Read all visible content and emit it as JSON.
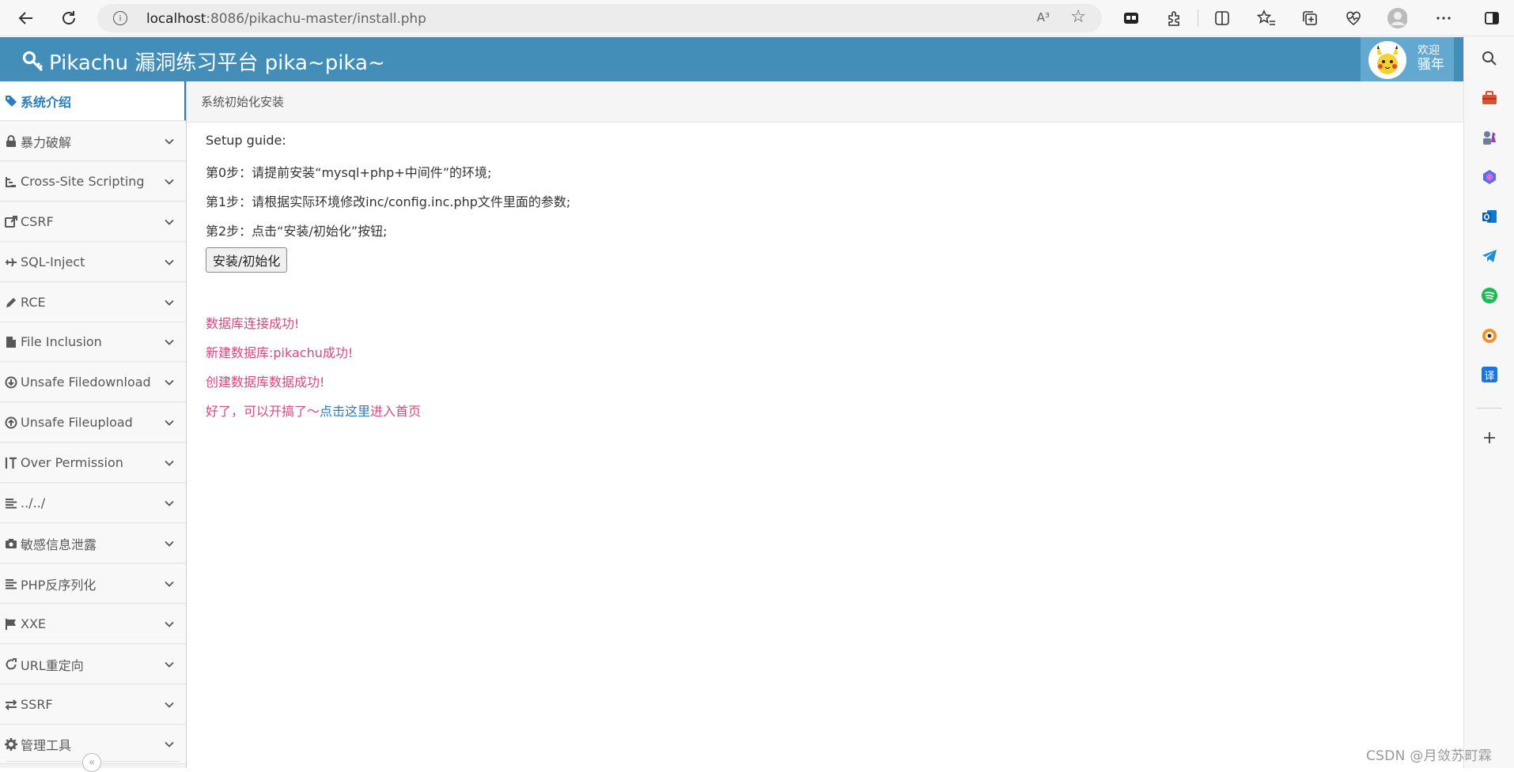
{
  "browser": {
    "url_host": "localhost",
    "url_rest": ":8086/pikachu-master/install.php",
    "read_aloud": "A³",
    "toolbar_icons": [
      "back-icon",
      "refresh-icon",
      "tab-actions-icon",
      "extensions-icon",
      "split-screen-icon",
      "favorites-icon",
      "collections-icon",
      "browser-essentials-icon",
      "profile-icon",
      "more-icon",
      "sidebar-toggle-icon"
    ]
  },
  "edge_sidebar": {
    "icons": [
      "search-icon",
      "tools-icon",
      "chess-icon",
      "copilot-icon",
      "outlook-icon",
      "telegram-icon",
      "spotify-icon",
      "game-icon",
      "translate-icon",
      "add-icon"
    ],
    "translate_glyph": "译"
  },
  "header": {
    "title": "Pikachu 漏洞练习平台 pika~pika~",
    "welcome": "欢迎",
    "user_name": "骚年"
  },
  "leftnav": {
    "items": [
      {
        "label": "系统介绍",
        "icon": "tag-icon",
        "active": true
      },
      {
        "label": "暴力破解",
        "icon": "lock-icon"
      },
      {
        "label": "Cross-Site Scripting",
        "icon": "sitemap-icon"
      },
      {
        "label": "CSRF",
        "icon": "share-icon"
      },
      {
        "label": "SQL-Inject",
        "icon": "plane-icon"
      },
      {
        "label": "RCE",
        "icon": "pencil-icon"
      },
      {
        "label": "File Inclusion",
        "icon": "file-icon"
      },
      {
        "label": "Unsafe Filedownload",
        "icon": "download-icon"
      },
      {
        "label": "Unsafe Fileupload",
        "icon": "upload-icon"
      },
      {
        "label": "Over Permission",
        "icon": "text-height-icon"
      },
      {
        "label": "../../",
        "icon": "align-left-icon"
      },
      {
        "label": "敏感信息泄露",
        "icon": "camera-icon"
      },
      {
        "label": "PHP反序列化",
        "icon": "align-left-icon"
      },
      {
        "label": "XXE",
        "icon": "flag-icon"
      },
      {
        "label": "URL重定向",
        "icon": "repeat-icon"
      },
      {
        "label": "SSRF",
        "icon": "exchange-icon"
      },
      {
        "label": "管理工具",
        "icon": "cog-icon"
      }
    ],
    "collapse_glyph": "«"
  },
  "breadcrumb": {
    "text": "系统初始化安装"
  },
  "main": {
    "guide_title": "Setup guide:",
    "step0": "第0步：请提前安装“mysql+php+中间件”的环境;",
    "step1": "第1步：请根据实际环境修改inc/config.inc.php文件里面的参数;",
    "step2": "第2步：点击“安装/初始化”按钮;",
    "install_button": "安装/初始化",
    "msg_db_connect": "数据库连接成功!",
    "msg_db_create": "新建数据库:pikachu成功!",
    "msg_data_create": "创建数据库数据成功!",
    "msg_done_prefix": "好了，可以开搞了～",
    "msg_done_link": "点击这里",
    "msg_done_suffix": "进入首页"
  },
  "watermark": "CSDN @月敛苏町霖"
}
